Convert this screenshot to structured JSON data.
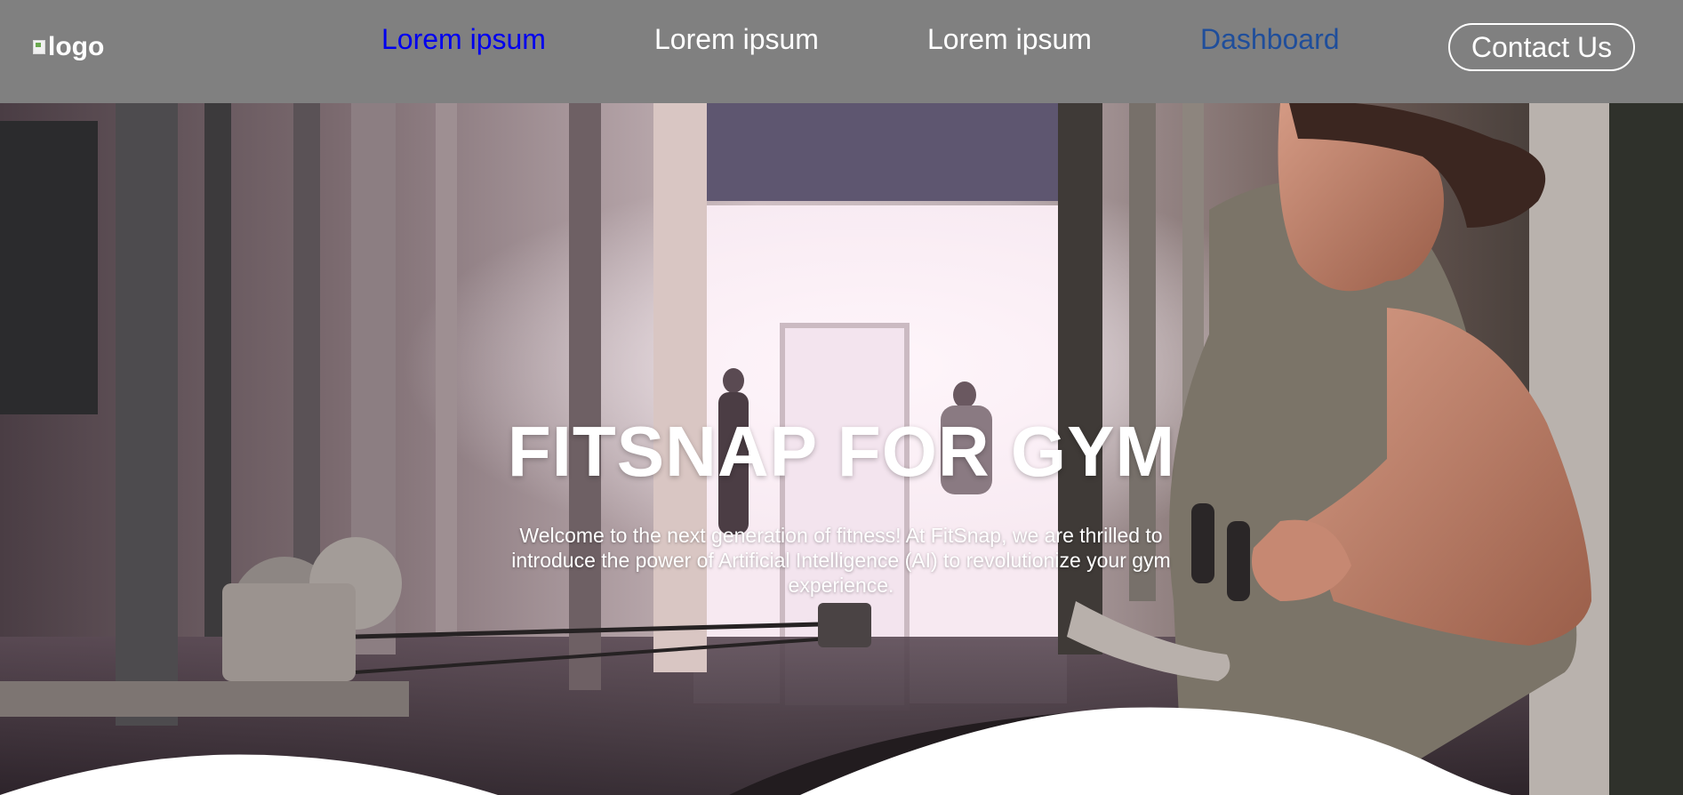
{
  "header": {
    "logo_alt": "logo",
    "nav": [
      {
        "label": "Lorem ipsum"
      },
      {
        "label": "Lorem ipsum"
      },
      {
        "label": "Lorem ipsum"
      },
      {
        "label": "Dashboard"
      }
    ],
    "contact_label": "Contact Us"
  },
  "hero": {
    "title": "FITSNAP FOR GYM",
    "description": "Welcome to the next generation of fitness! At FitSnap, we are thrilled to introduce the power of Artificial Intelligence (AI) to revolutionize your gym experience."
  },
  "colors": {
    "header_bg": "#808080",
    "nav_link_visited": "#0000ee",
    "nav_link_dashboard": "#1f4e9b",
    "text": "#ffffff"
  }
}
